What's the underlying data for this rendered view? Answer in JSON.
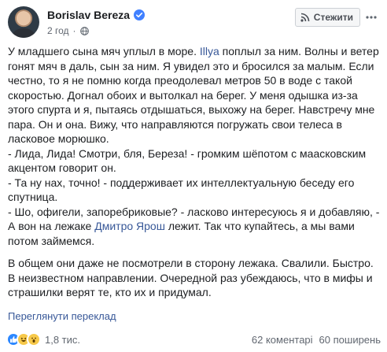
{
  "post": {
    "author": "Borislav Bereza",
    "time": "2 год",
    "follow_label": "Стежити",
    "paragraphs": [
      {
        "parts": [
          {
            "text": "У младшего сына мяч уплыл в море. "
          },
          {
            "text": "Illya",
            "mention": true
          },
          {
            "text": " поплыл за ним. Волны и ветер гонят мяч в даль, сын за ним. Я увидел это и бросился за малым. Если честно, то я не помню когда преодолевал метров 50 в воде с такой скоростью. Догнал обоих и вытолкал на берег. У меня одышка из-за этого спурта и я, пытаясь отдышаться, выхожу на берег. Навстречу мне пара. Он и она. Вижу, что направляются погружать свои телеса в ласковое морюшко.\n- Лида, Лида! Смотри, бля, Береза! - громким шёпотом с маасковским акцентом говорит он.\n- Та ну нах, точно! - поддерживает их интеллектуальную беседу его спутница.\n- Шо, офигели, запоребриковые? - ласково интересуюсь я и добавляю, - А вон на лежаке "
          },
          {
            "text": "Дмитро Ярош",
            "mention": true
          },
          {
            "text": " лежит. Так что купайтесь, а мы вами потом займемся."
          }
        ]
      },
      {
        "parts": [
          {
            "text": "В общем они даже не посмотрели в сторону лежака. Свалили. Быстро. В неизвестном направлении. Очередной раз убеждаюсь, что в мифы и страшилки верят те, кто их и придумал."
          }
        ]
      }
    ],
    "translate_label": "Переглянути переклад",
    "reactions_count": "1,8 тис.",
    "comments": "62 коментарі",
    "shares": "60 поширень"
  },
  "colors": {
    "link": "#385898",
    "text": "#1c1e21",
    "meta": "#616770",
    "like": "#2d88ff",
    "emoji": "#f7c94a"
  },
  "icons": [
    "verified-icon",
    "globe-icon",
    "rss-icon",
    "more-icon",
    "like-icon",
    "haha-icon",
    "wow-icon"
  ]
}
